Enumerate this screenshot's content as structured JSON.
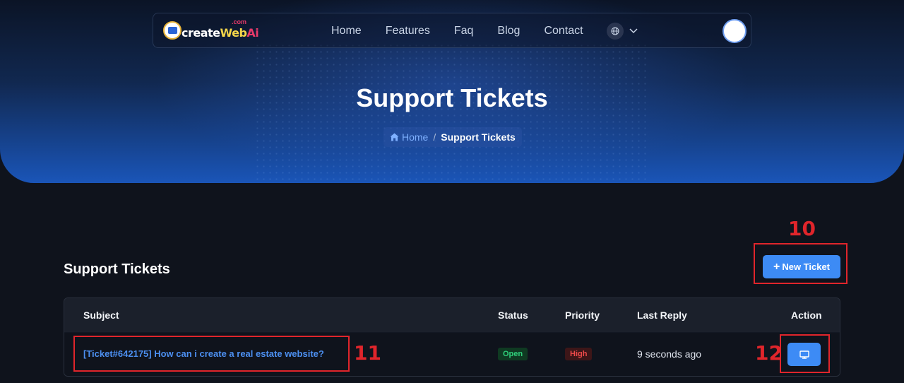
{
  "navbar": {
    "logo": {
      "prefix": "create",
      "web": "Web",
      "ai": "Ai",
      "com": ".com"
    },
    "links": [
      "Home",
      "Features",
      "Faq",
      "Blog",
      "Contact"
    ],
    "language_icon": "globe-icon"
  },
  "hero": {
    "title": "Support Tickets",
    "breadcrumb": {
      "home": "Home",
      "separator": "/",
      "current": "Support Tickets"
    }
  },
  "tickets": {
    "section_title": "Support Tickets",
    "new_ticket_label": "New Ticket",
    "columns": [
      "Subject",
      "Status",
      "Priority",
      "Last Reply",
      "Action"
    ],
    "rows": [
      {
        "subject": "[Ticket#642175] How can i create a real estate website?",
        "status": "Open",
        "priority": "High",
        "last_reply": "9 seconds ago",
        "action_icon": "monitor-icon"
      }
    ]
  },
  "annotations": [
    "10",
    "11",
    "12"
  ],
  "colors": {
    "accent": "#3d8bf5",
    "status_open": "#2fd07a",
    "priority_high": "#f04a4a",
    "annotation": "#e0252b"
  }
}
